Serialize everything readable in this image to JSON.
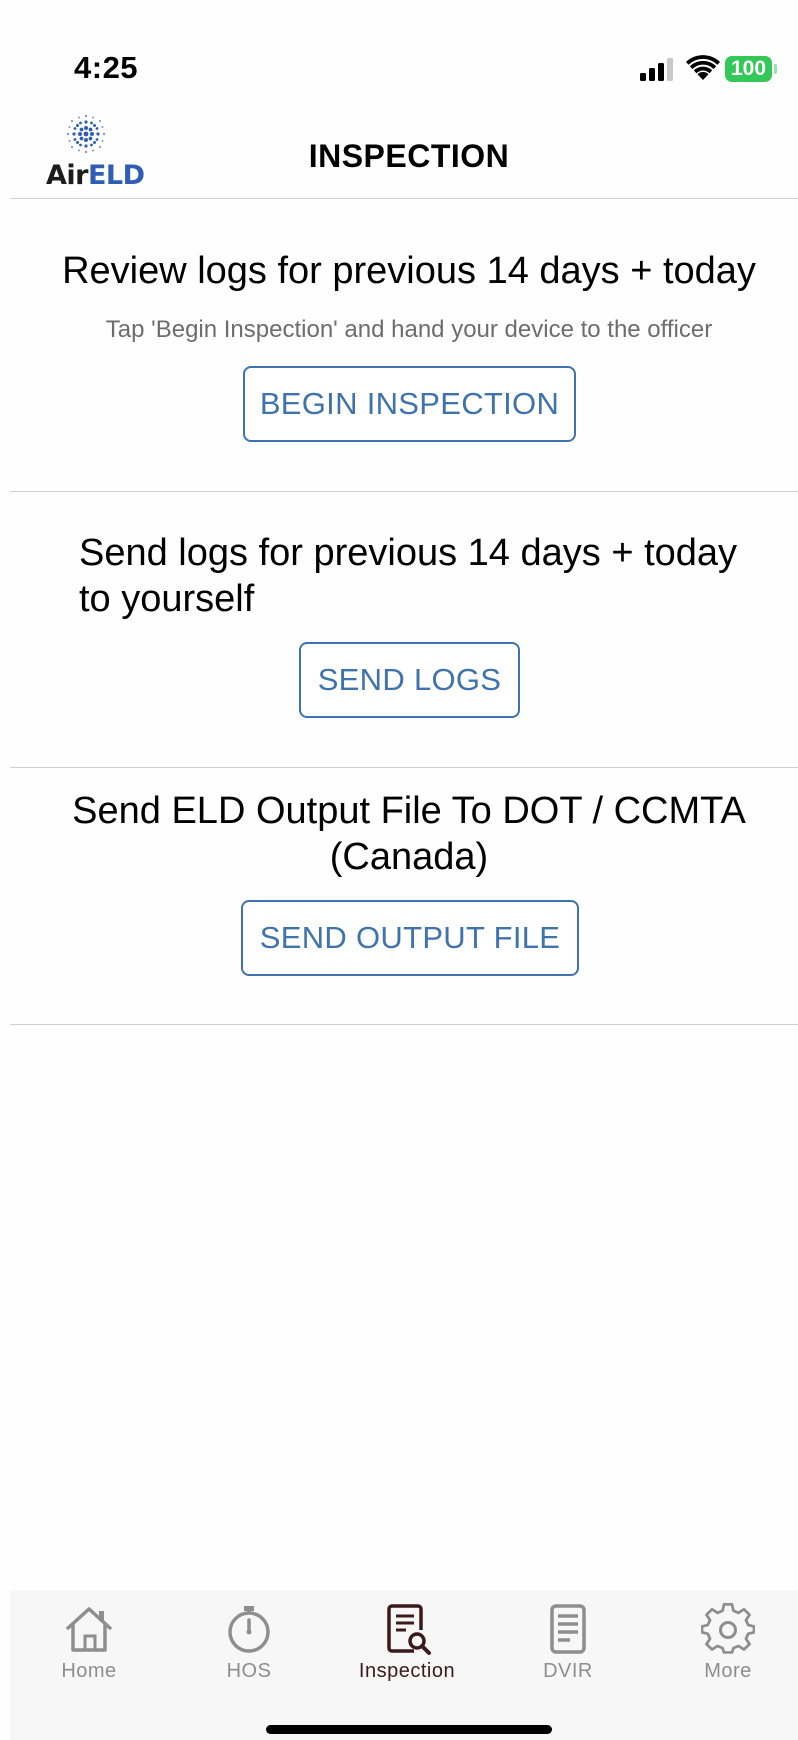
{
  "status_bar": {
    "time": "4:25",
    "battery": "100",
    "icons": [
      "cellular-signal-icon",
      "wifi-icon",
      "battery-icon"
    ]
  },
  "header": {
    "logo_air": "Air",
    "logo_eld": "ELD",
    "title": "INSPECTION"
  },
  "sections": {
    "review": {
      "heading": "Review logs for previous 14 days +  today",
      "subtitle": "Tap 'Begin Inspection' and hand your device to the officer",
      "button": "BEGIN INSPECTION"
    },
    "send_logs": {
      "heading_line1": "Send logs for previous 14 days + today",
      "heading_line2": "to yourself",
      "button": "SEND LOGS"
    },
    "output_file": {
      "heading_line1": "Send ELD Output File To DOT / CCMTA",
      "heading_line2": "(Canada)",
      "button": "SEND OUTPUT FILE"
    }
  },
  "tab_bar": {
    "active": "Inspection",
    "tabs": [
      {
        "label": "Home",
        "icon": "home-icon"
      },
      {
        "label": "HOS",
        "icon": "stopwatch-icon"
      },
      {
        "label": "Inspection",
        "icon": "inspection-search-icon"
      },
      {
        "label": "DVIR",
        "icon": "document-icon"
      },
      {
        "label": "More",
        "icon": "gear-icon"
      }
    ]
  },
  "colors": {
    "accent": "#3e73ad",
    "battery": "#34c759",
    "logo_blue": "#2f5fb5",
    "active_tab": "#3a1a1a",
    "inactive_tab": "#8e8e8e"
  }
}
